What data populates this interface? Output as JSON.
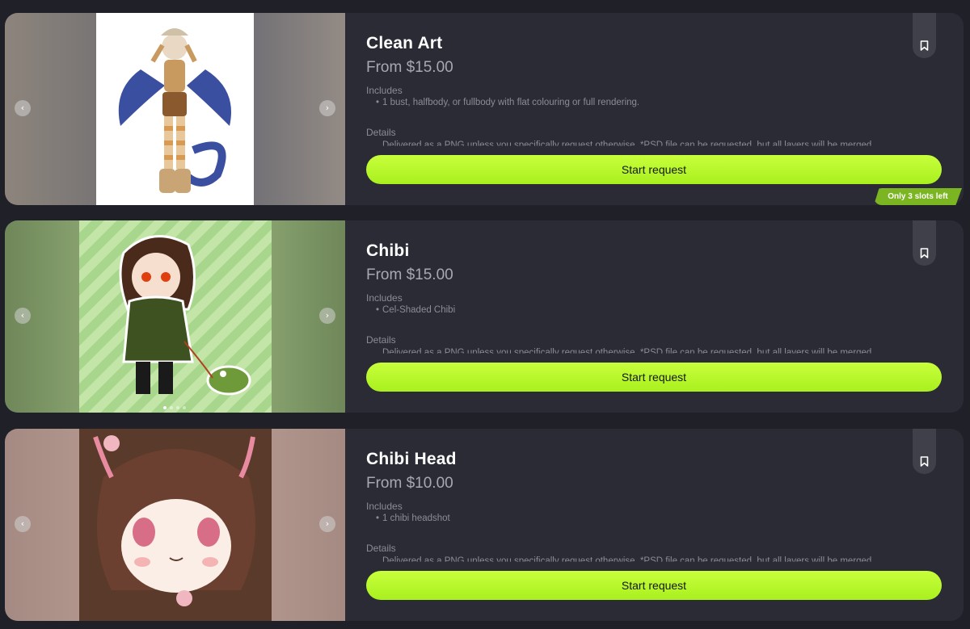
{
  "cards": [
    {
      "title": "Clean Art",
      "price": "From $15.00",
      "includes_label": "Includes",
      "includes_item": "1 bust, halfbody, or fullbody with flat colouring or full rendering.",
      "details_label": "Details",
      "details_item": "Delivered as a PNG unless you specifically request otherwise. *PSD file can be requested, but all layers will be merged.",
      "button_label": "Start request",
      "badge": "Only 3 slots left"
    },
    {
      "title": "Chibi",
      "price": "From $15.00",
      "includes_label": "Includes",
      "includes_item": "Cel-Shaded Chibi",
      "details_label": "Details",
      "details_item": "Delivered as a PNG unless you specifically request otherwise. *PSD file can be requested, but all layers will be merged.",
      "button_label": "Start request"
    },
    {
      "title": "Chibi Head",
      "price": "From $10.00",
      "includes_label": "Includes",
      "includes_item": "1 chibi headshot",
      "details_label": "Details",
      "details_item": "Delivered as a PNG unless you specifically request otherwise. *PSD file can be requested, but all layers will be merged.",
      "button_label": "Start request"
    }
  ],
  "icons": {
    "prev": "chevron-left-icon",
    "next": "chevron-right-icon",
    "bookmark": "bookmark-icon"
  },
  "colors": {
    "background": "#1f2028",
    "card": "#2a2b35",
    "accent": "#b8f72a",
    "badge": "#7bb521"
  }
}
